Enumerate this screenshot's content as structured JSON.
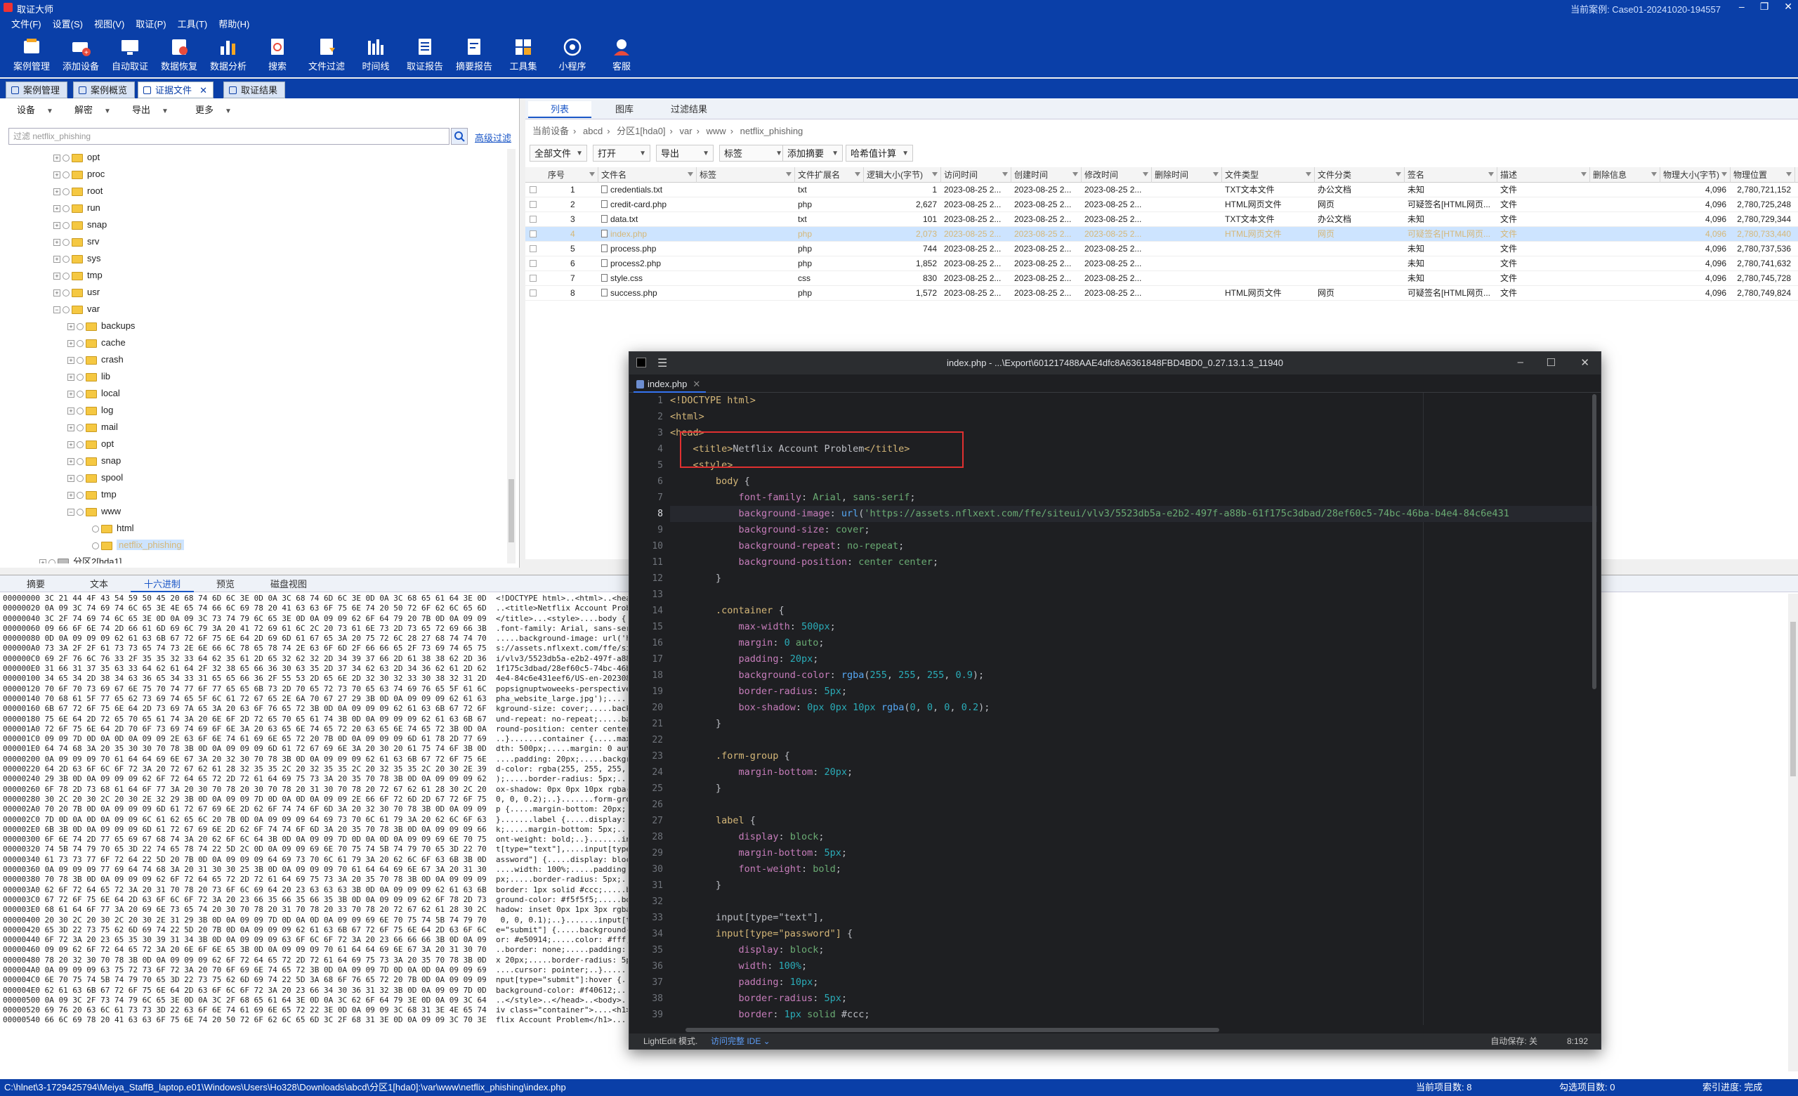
{
  "app": {
    "title": "取证大师",
    "current_case": "当前案例: Case01-20241020-194557"
  },
  "menu": [
    "文件(F)",
    "设置(S)",
    "视图(V)",
    "取证(P)",
    "工具(T)",
    "帮助(H)"
  ],
  "toolbar": [
    "案例管理",
    "添加设备",
    "自动取证",
    "数据恢复",
    "数据分析",
    "搜索",
    "文件过滤",
    "时间线",
    "取证报告",
    "摘要报告",
    "工具集",
    "小程序",
    "客服"
  ],
  "tabs": [
    "案例管理",
    "案例概览",
    "证据文件",
    "取证结果"
  ],
  "left": {
    "dropdowns": [
      "设备",
      "解密",
      "导出",
      "更多"
    ],
    "filter_placeholder": "过滤 netflix_phishing",
    "advanced": "高级过滤",
    "tree": [
      {
        "label": "opt",
        "level": 0
      },
      {
        "label": "proc",
        "level": 0
      },
      {
        "label": "root",
        "level": 0
      },
      {
        "label": "run",
        "level": 0
      },
      {
        "label": "snap",
        "level": 0
      },
      {
        "label": "srv",
        "level": 0
      },
      {
        "label": "sys",
        "level": 0
      },
      {
        "label": "tmp",
        "level": 0
      },
      {
        "label": "usr",
        "level": 0
      },
      {
        "label": "var",
        "level": 0
      },
      {
        "label": "backups",
        "level": 1
      },
      {
        "label": "cache",
        "level": 1
      },
      {
        "label": "crash",
        "level": 1
      },
      {
        "label": "lib",
        "level": 1
      },
      {
        "label": "local",
        "level": 1
      },
      {
        "label": "log",
        "level": 1
      },
      {
        "label": "mail",
        "level": 1
      },
      {
        "label": "opt",
        "level": 1
      },
      {
        "label": "snap",
        "level": 1
      },
      {
        "label": "spool",
        "level": 1
      },
      {
        "label": "tmp",
        "level": 1
      },
      {
        "label": "www",
        "level": 1
      },
      {
        "label": "html",
        "level": 2
      },
      {
        "label": "netflix_phishing",
        "level": 2
      },
      {
        "label": "分区2[hda1]",
        "level": -1
      }
    ]
  },
  "right": {
    "view_tabs": [
      "列表",
      "图库",
      "过滤结果"
    ],
    "breadcrumb": [
      "当前设备",
      "abcd",
      "分区1[hda0]",
      "var",
      "www",
      "netflix_phishing"
    ],
    "actions": [
      "全部文件",
      "打开",
      "导出",
      "标签",
      "添加摘要",
      "哈希值计算"
    ],
    "columns": [
      "序号",
      "文件名",
      "标签",
      "文件扩展名",
      "逻辑大小(字节)",
      "访问时间",
      "创建时间",
      "修改时间",
      "删除时间",
      "文件类型",
      "文件分类",
      "签名",
      "描述",
      "删除信息",
      "物理大小(字节)",
      "物理位置"
    ],
    "rows": [
      [
        "1",
        "credentials.txt",
        "",
        "txt",
        "1",
        "2023-08-25 2...",
        "2023-08-25 2...",
        "2023-08-25 2...",
        "",
        "TXT文本文件",
        "办公文档",
        "未知",
        "文件",
        "",
        "4,096",
        "2,780,721,152"
      ],
      [
        "2",
        "credit-card.php",
        "",
        "php",
        "2,627",
        "2023-08-25 2...",
        "2023-08-25 2...",
        "2023-08-25 2...",
        "",
        "HTML网页文件",
        "网页",
        "可疑签名[HTML网页...",
        "文件",
        "",
        "4,096",
        "2,780,725,248"
      ],
      [
        "3",
        "data.txt",
        "",
        "txt",
        "101",
        "2023-08-25 2...",
        "2023-08-25 2...",
        "2023-08-25 2...",
        "",
        "TXT文本文件",
        "办公文档",
        "未知",
        "文件",
        "",
        "4,096",
        "2,780,729,344"
      ],
      [
        "4",
        "index.php",
        "",
        "php",
        "2,073",
        "2023-08-25 2...",
        "2023-08-25 2...",
        "2023-08-25 2...",
        "",
        "HTML网页文件",
        "网页",
        "可疑签名[HTML网页...",
        "文件",
        "",
        "4,096",
        "2,780,733,440"
      ],
      [
        "5",
        "process.php",
        "",
        "php",
        "744",
        "2023-08-25 2...",
        "2023-08-25 2...",
        "2023-08-25 2...",
        "",
        "",
        "",
        "未知",
        "文件",
        "",
        "4,096",
        "2,780,737,536"
      ],
      [
        "6",
        "process2.php",
        "",
        "php",
        "1,852",
        "2023-08-25 2...",
        "2023-08-25 2...",
        "2023-08-25 2...",
        "",
        "",
        "",
        "未知",
        "文件",
        "",
        "4,096",
        "2,780,741,632"
      ],
      [
        "7",
        "style.css",
        "",
        "css",
        "830",
        "2023-08-25 2...",
        "2023-08-25 2...",
        "2023-08-25 2...",
        "",
        "",
        "",
        "未知",
        "文件",
        "",
        "4,096",
        "2,780,745,728"
      ],
      [
        "8",
        "success.php",
        "",
        "php",
        "1,572",
        "2023-08-25 2...",
        "2023-08-25 2...",
        "2023-08-25 2...",
        "",
        "HTML网页文件",
        "网页",
        "可疑签名[HTML网页...",
        "文件",
        "",
        "4,096",
        "2,780,749,824"
      ]
    ]
  },
  "bottom": {
    "tabs": [
      "摘要",
      "文本",
      "十六进制",
      "预览",
      "磁盘视图"
    ],
    "hex_lines": [
      "00000000 3C 21 44 4F 43 54 59 50 45 20 68 74 6D 6C 3E 0D 0A 3C 68 74 6D 6C 3E 0D 0A 3C 68 65 61 64 3E 0D  <!DOCTYPE html>..<html>..<head>.",
      "00000020 0A 09 3C 74 69 74 6C 65 3E 4E 65 74 66 6C 69 78 20 41 63 63 6F 75 6E 74 20 50 72 6F 62 6C 65 6D  ..<title>Netflix Account Problem",
      "00000040 3C 2F 74 69 74 6C 65 3E 0D 0A 09 3C 73 74 79 6C 65 3E 0D 0A 09 09 62 6F 64 79 20 7B 0D 0A 09 09  </title>...<style>....body {....",
      "00000060 09 66 6F 6E 74 2D 66 61 6D 69 6C 79 3A 20 41 72 69 61 6C 2C 20 73 61 6E 73 2D 73 65 72 69 66 3B  .font-family: Arial, sans-serif;",
      "00000080 0D 0A 09 09 09 62 61 63 6B 67 72 6F 75 6E 64 2D 69 6D 61 67 65 3A 20 75 72 6C 28 27 68 74 74 70  .....background-image: url('http",
      "000000A0 73 3A 2F 2F 61 73 73 65 74 73 2E 6E 66 6C 78 65 78 74 2E 63 6F 6D 2F 66 66 65 2F 73 69 74 65 75  s://assets.nflxext.com/ffe/siteu",
      "000000C0 69 2F 76 6C 76 33 2F 35 35 32 33 64 62 35 61 2D 65 32 62 32 2D 34 39 37 66 2D 61 38 38 62 2D 36  i/vlv3/5523db5a-e2b2-497f-a88b-6",
      "000000E0 31 66 31 37 35 63 33 64 62 61 64 2F 32 38 65 66 36 30 63 35 2D 37 34 62 63 2D 34 36 62 61 2D 62  1f175c3dbad/28ef60c5-74bc-46ba-b",
      "00000100 34 65 34 2D 38 34 63 36 65 34 33 31 65 65 66 36 2F 55 53 2D 65 6E 2D 32 30 32 33 30 38 32 31 2D  4e4-84c6e431eef6/US-en-20230821-",
      "00000120 70 6F 70 73 69 67 6E 75 70 74 77 6F 77 65 65 6B 73 2D 70 65 72 73 70 65 63 74 69 76 65 5F 61 6C  popsignuptwoweeks-perspective_al",
      "00000140 70 68 61 5F 77 65 62 73 69 74 65 5F 6C 61 72 67 65 2E 6A 70 67 27 29 3B 0D 0A 09 09 09 62 61 63  pha_website_large.jpg');.....bac",
      "00000160 6B 67 72 6F 75 6E 64 2D 73 69 7A 65 3A 20 63 6F 76 65 72 3B 0D 0A 09 09 09 62 61 63 6B 67 72 6F  kground-size: cover;.....backgro",
      "00000180 75 6E 64 2D 72 65 70 65 61 74 3A 20 6E 6F 2D 72 65 70 65 61 74 3B 0D 0A 09 09 09 62 61 63 6B 67  und-repeat: no-repeat;.....backg",
      "000001A0 72 6F 75 6E 64 2D 70 6F 73 69 74 69 6F 6E 3A 20 63 65 6E 74 65 72 20 63 65 6E 74 65 72 3B 0D 0A  round-position: center center;..",
      "000001C0 09 09 7D 0D 0A 0D 0A 09 09 2E 63 6F 6E 74 61 69 6E 65 72 20 7B 0D 0A 09 09 09 6D 61 78 2D 77 69  ..}.......container {.....max-wi",
      "000001E0 64 74 68 3A 20 35 30 30 70 78 3B 0D 0A 09 09 09 6D 61 72 67 69 6E 3A 20 30 20 61 75 74 6F 3B 0D  dth: 500px;.....margin: 0 auto;.",
      "00000200 0A 09 09 09 70 61 64 64 69 6E 67 3A 20 32 30 70 78 3B 0D 0A 09 09 09 62 61 63 6B 67 72 6F 75 6E  ....padding: 20px;.....backgroun",
      "00000220 64 2D 63 6F 6C 6F 72 3A 20 72 67 62 61 28 32 35 35 2C 20 32 35 35 2C 20 32 35 35 2C 20 30 2E 39  d-color: rgba(255, 255, 255, 0.9",
      "00000240 29 3B 0D 0A 09 09 09 62 6F 72 64 65 72 2D 72 61 64 69 75 73 3A 20 35 70 78 3B 0D 0A 09 09 09 62  );.....border-radius: 5px;.....b",
      "00000260 6F 78 2D 73 68 61 64 6F 77 3A 20 30 70 78 20 30 70 78 20 31 30 70 78 20 72 67 62 61 28 30 2C 20  ox-shadow: 0px 0px 10px rgba(0, ",
      "00000280 30 2C 20 30 2C 20 30 2E 32 29 3B 0D 0A 09 09 7D 0D 0A 0D 0A 09 09 2E 66 6F 72 6D 2D 67 72 6F 75  0, 0, 0.2);..}.......form-grou",
      "000002A0 70 20 7B 0D 0A 09 09 09 6D 61 72 67 69 6E 2D 62 6F 74 74 6F 6D 3A 20 32 30 70 78 3B 0D 0A 09 09  p {.....margin-bottom: 20px;....",
      "000002C0 7D 0D 0A 0D 0A 09 09 6C 61 62 65 6C 20 7B 0D 0A 09 09 09 64 69 73 70 6C 61 79 3A 20 62 6C 6F 63  }.......label {.....display: bloc",
      "000002E0 6B 3B 0D 0A 09 09 09 6D 61 72 67 69 6E 2D 62 6F 74 74 6F 6D 3A 20 35 70 78 3B 0D 0A 09 09 09 66  k;.....margin-bottom: 5px;.....f",
      "00000300 6F 6E 74 2D 77 65 69 67 68 74 3A 20 62 6F 6C 64 3B 0D 0A 09 09 7D 0D 0A 0D 0A 09 09 69 6E 70 75  ont-weight: bold;..}.......inpu",
      "00000320 74 5B 74 79 70 65 3D 22 74 65 78 74 22 5D 2C 0D 0A 09 09 69 6E 70 75 74 5B 74 79 70 65 3D 22 70  t[type=\"text\"],....input[type=\"p",
      "00000340 61 73 73 77 6F 72 64 22 5D 20 7B 0D 0A 09 09 09 64 69 73 70 6C 61 79 3A 20 62 6C 6F 63 6B 3B 0D  assword\"] {.....display: block;.",
      "00000360 0A 09 09 09 77 69 64 74 68 3A 20 31 30 30 25 3B 0D 0A 09 09 09 70 61 64 64 69 6E 67 3A 20 31 30  ....width: 100%;.....padding: 10",
      "00000380 70 78 3B 0D 0A 09 09 09 62 6F 72 64 65 72 2D 72 61 64 69 75 73 3A 20 35 70 78 3B 0D 0A 09 09 09  px;.....border-radius: 5px;.....",
      "000003A0 62 6F 72 64 65 72 3A 20 31 70 78 20 73 6F 6C 69 64 20 23 63 63 63 3B 0D 0A 09 09 09 62 61 63 6B  border: 1px solid #ccc;.....back",
      "000003C0 67 72 6F 75 6E 64 2D 63 6F 6C 6F 72 3A 20 23 66 35 66 35 66 35 3B 0D 0A 09 09 09 62 6F 78 2D 73  ground-color: #f5f5f5;.....box-s",
      "000003E0 68 61 64 6F 77 3A 20 69 6E 73 65 74 20 30 70 78 20 31 70 78 20 33 70 78 20 72 67 62 61 28 30 2C  hadow: inset 0px 1px 3px rgba(0,",
      "00000400 20 30 2C 20 30 2C 20 30 2E 31 29 3B 0D 0A 09 09 7D 0D 0A 0D 0A 09 09 69 6E 70 75 74 5B 74 79 70   0, 0, 0.1);..}.......input[typ",
      "00000420 65 3D 22 73 75 62 6D 69 74 22 5D 20 7B 0D 0A 09 09 09 62 61 63 6B 67 72 6F 75 6E 64 2D 63 6F 6C  e=\"submit\"] {.....background-col",
      "00000440 6F 72 3A 20 23 65 35 30 39 31 34 3B 0D 0A 09 09 09 63 6F 6C 6F 72 3A 20 23 66 66 66 3B 0D 0A 09  or: #e50914;.....color: #fff;...",
      "00000460 09 09 62 6F 72 64 65 72 3A 20 6E 6F 6E 65 3B 0D 0A 09 09 09 70 61 64 64 69 6E 67 3A 20 31 30 70  ..border: none;.....padding: 10p",
      "00000480 78 20 32 30 70 78 3B 0D 0A 09 09 09 62 6F 72 64 65 72 2D 72 61 64 69 75 73 3A 20 35 70 78 3B 0D  x 20px;.....border-radius: 5px;.",
      "000004A0 0A 09 09 09 63 75 72 73 6F 72 3A 20 70 6F 69 6E 74 65 72 3B 0D 0A 09 09 7D 0D 0A 0D 0A 09 09 69  ....cursor: pointer;..}.......i",
      "000004C0 6E 70 75 74 5B 74 79 70 65 3D 22 73 75 62 6D 69 74 22 5D 3A 68 6F 76 65 72 20 7B 0D 0A 09 09 09  nput[type=\"submit\"]:hover {....",
      "000004E0 62 61 63 6B 67 72 6F 75 6E 64 2D 63 6F 6C 6F 72 3A 20 23 66 34 30 36 31 32 3B 0D 0A 09 09 7D 0D  background-color: #f40612;...}.",
      "00000500 0A 09 3C 2F 73 74 79 6C 65 3E 0D 0A 3C 2F 68 65 61 64 3E 0D 0A 3C 62 6F 64 79 3E 0D 0A 09 3C 64  ..</style>..</head>..<body>...<d",
      "00000520 69 76 20 63 6C 61 73 73 3D 22 63 6F 6E 74 61 69 6E 65 72 22 3E 0D 0A 09 09 3C 68 31 3E 4E 65 74  iv class=\"container\">....<h1>Net",
      "00000540 66 6C 69 78 20 41 63 63 6F 75 6E 74 20 50 72 6F 62 6C 65 6D 3C 2F 68 31 3E 0D 0A 09 09 3C 70 3E  flix Account Problem</h1>....<p>"
    ]
  },
  "editor": {
    "title": "index.php - ...\\Export\\601217488AAE4dfc8A6361848FBD4BD0_0.27.13.1.3_11940",
    "tab": "index.php",
    "status_left": "LightEdit 模式.",
    "status_link": "访问完整 IDE ⌄",
    "status_right": "自动保存: 关",
    "caret": "8:192",
    "lines": [
      "<!DOCTYPE html>",
      "<html>",
      "<head>",
      "    <title>Netflix Account Problem</title>",
      "    <style>",
      "        body {",
      "            font-family: Arial, sans-serif;",
      "            background-image: url('https://assets.nflxext.com/ffe/siteui/vlv3/5523db5a-e2b2-497f-a88b-61f175c3dbad/28ef60c5-74bc-46ba-b4e4-84c6e431",
      "            background-size: cover;",
      "            background-repeat: no-repeat;",
      "            background-position: center center;",
      "        }",
      "",
      "        .container {",
      "            max-width: 500px;",
      "            margin: 0 auto;",
      "            padding: 20px;",
      "            background-color: rgba(255, 255, 255, 0.9);",
      "            border-radius: 5px;",
      "            box-shadow: 0px 0px 10px rgba(0, 0, 0, 0.2);",
      "        }",
      "",
      "        .form-group {",
      "            margin-bottom: 20px;",
      "        }",
      "",
      "        label {",
      "            display: block;",
      "            margin-bottom: 5px;",
      "            font-weight: bold;",
      "        }",
      "",
      "        input[type=\"text\"],",
      "        input[type=\"password\"] {",
      "            display: block;",
      "            width: 100%;",
      "            padding: 10px;",
      "            border-radius: 5px;",
      "            border: 1px solid #ccc;"
    ]
  },
  "status": {
    "path": "C:\\hlnet\\3-1729425794\\Meiya_StaffB_laptop.e01\\Windows\\Users\\Ho328\\Downloads\\abcd\\分区1[hda0]:\\var\\www\\netflix_phishing\\index.php",
    "items": "当前项目数: 8",
    "checked": "勾选项目数: 0",
    "index": "索引进度: 完成"
  }
}
